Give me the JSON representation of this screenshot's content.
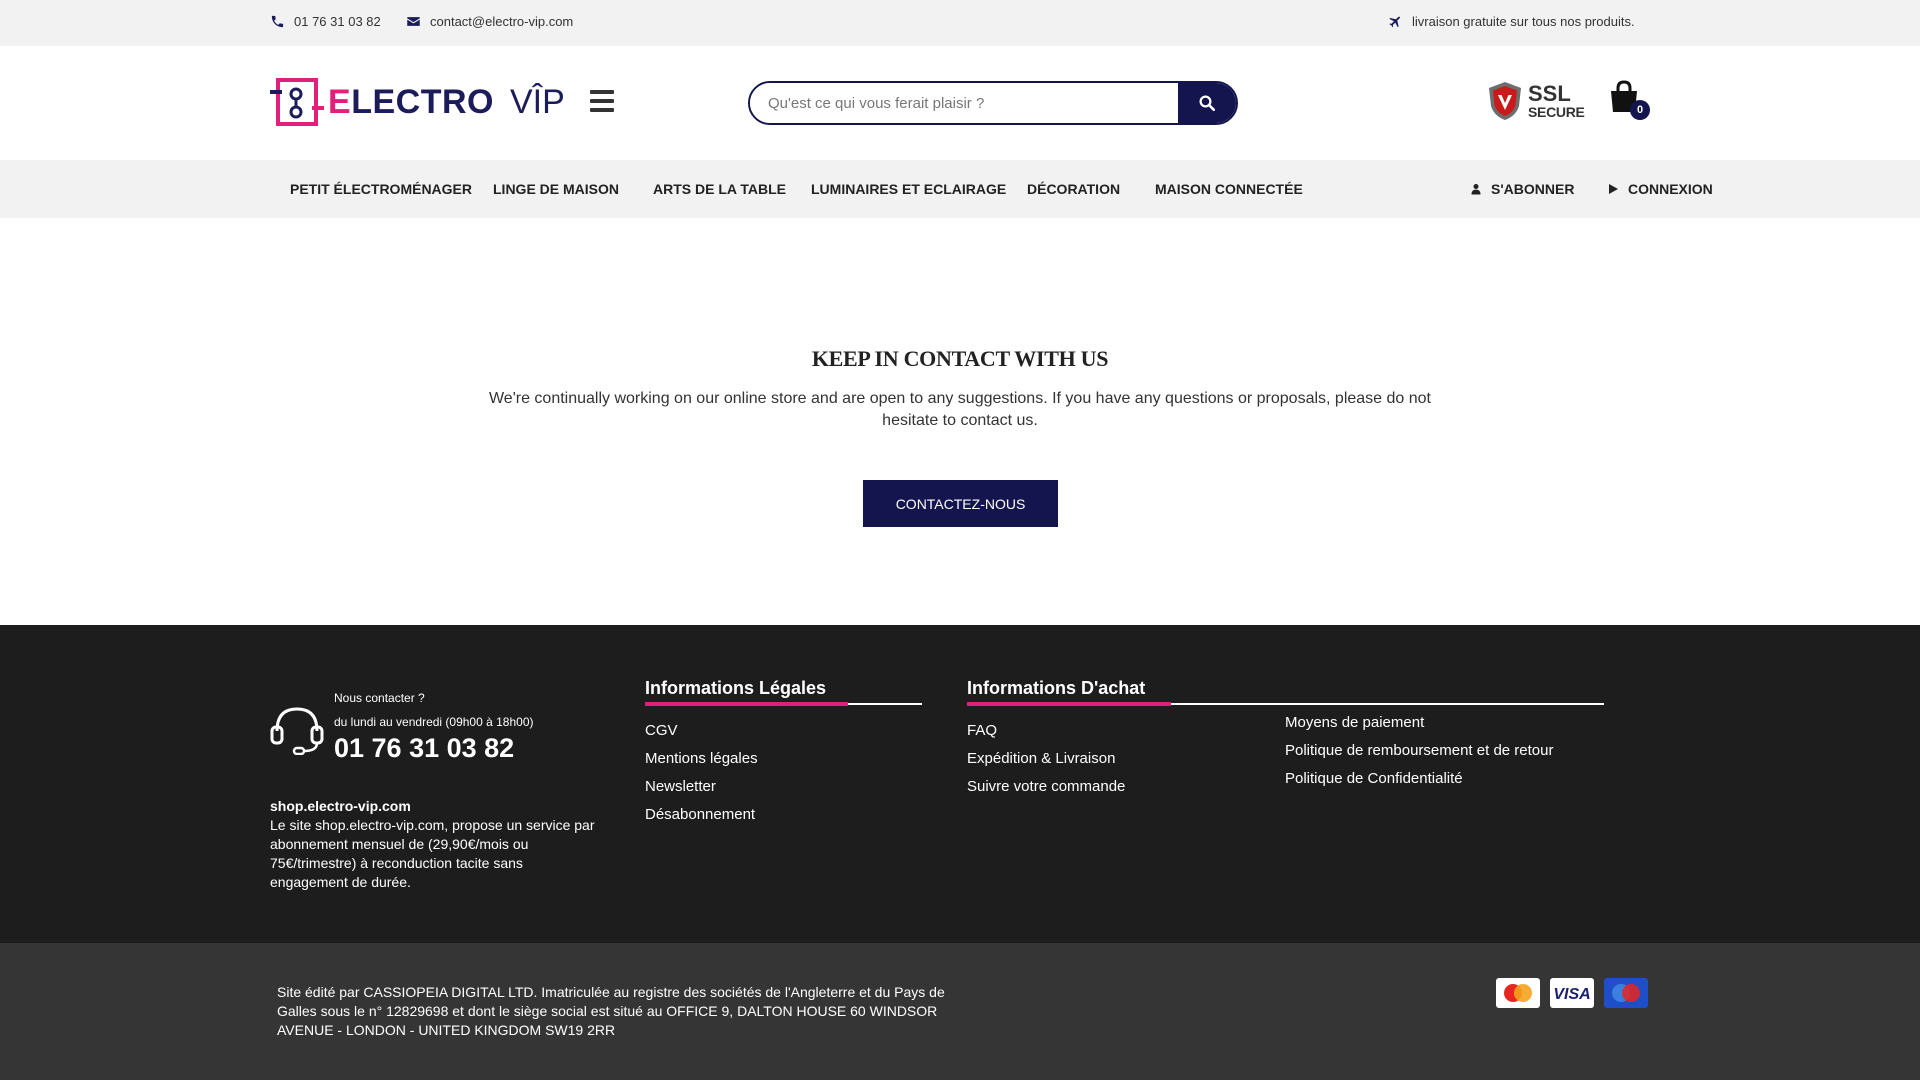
{
  "topbar": {
    "phone": "01 76 31 03 82",
    "email": "contact@electro-vip.com",
    "shipping_notice": "livraison gratuite sur tous nos produits."
  },
  "header": {
    "logo_part1": "ELECTRO",
    "logo_part2": "VÎP",
    "search_placeholder": "Qu'est ce qui vous ferait plaisir ?",
    "ssl_label": "SSL",
    "secure_label": "SECURE",
    "cart_count": "0"
  },
  "nav": {
    "items": [
      "PETIT ÉLECTROMÉNAGER",
      "LINGE DE MAISON",
      "ARTS DE LA TABLE",
      "LUMINAIRES ET ECLAIRAGE",
      "DÉCORATION",
      "MAISON CONNECTÉE"
    ],
    "subscribe": "S'ABONNER",
    "login": "CONNEXION"
  },
  "main": {
    "title": "KEEP IN CONTACT WITH US",
    "text": "We're continually working on our online store and are open to any suggestions. If you have any questions or proposals, please do not hesitate to contact us.",
    "button": "CONTACTEZ-NOUS"
  },
  "footer": {
    "help_title": "Nous contacter ?",
    "help_hours": "du lundi au vendredi (09h00 à 18h00)",
    "help_phone": "01 76 31 03 82",
    "site_name": "shop.electro-vip.com",
    "site_desc": "Le site shop.electro-vip.com, propose un service par abonnement mensuel de (29,90€/mois ou 75€/trimestre) à reconduction tacite sans engagement de durée.",
    "legal_title": "Informations Légales",
    "legal_links": [
      "CGV",
      "Mentions légales",
      "Newsletter",
      "Désabonnement"
    ],
    "purchase_title": "Informations D'achat",
    "purchase_links_col1": [
      "FAQ",
      "Expédition & Livraison",
      "Suivre votre commande"
    ],
    "purchase_links_col2": [
      "Moyens de paiement",
      "Politique de remboursement et de retour",
      "Politique de Confidentialité"
    ]
  },
  "bottom": {
    "legal_text": "Site édité par CASSIOPEIA DIGITAL LTD. Imatriculée au registre des sociétés de l'Angleterre et du Pays de Galles sous le n° 12829698 et dont le siège social est situé au OFFICE 9, DALTON HOUSE 60 WINDSOR AVENUE - LONDON - UNITED KINGDOM SW19 2RR",
    "cards": [
      "MasterCard",
      "VISA",
      "Maestro"
    ]
  },
  "colors": {
    "navy": "#14144f",
    "pink": "#e0207a",
    "footer_bg": "#1d1d1d",
    "bottom_bg": "#353535"
  }
}
